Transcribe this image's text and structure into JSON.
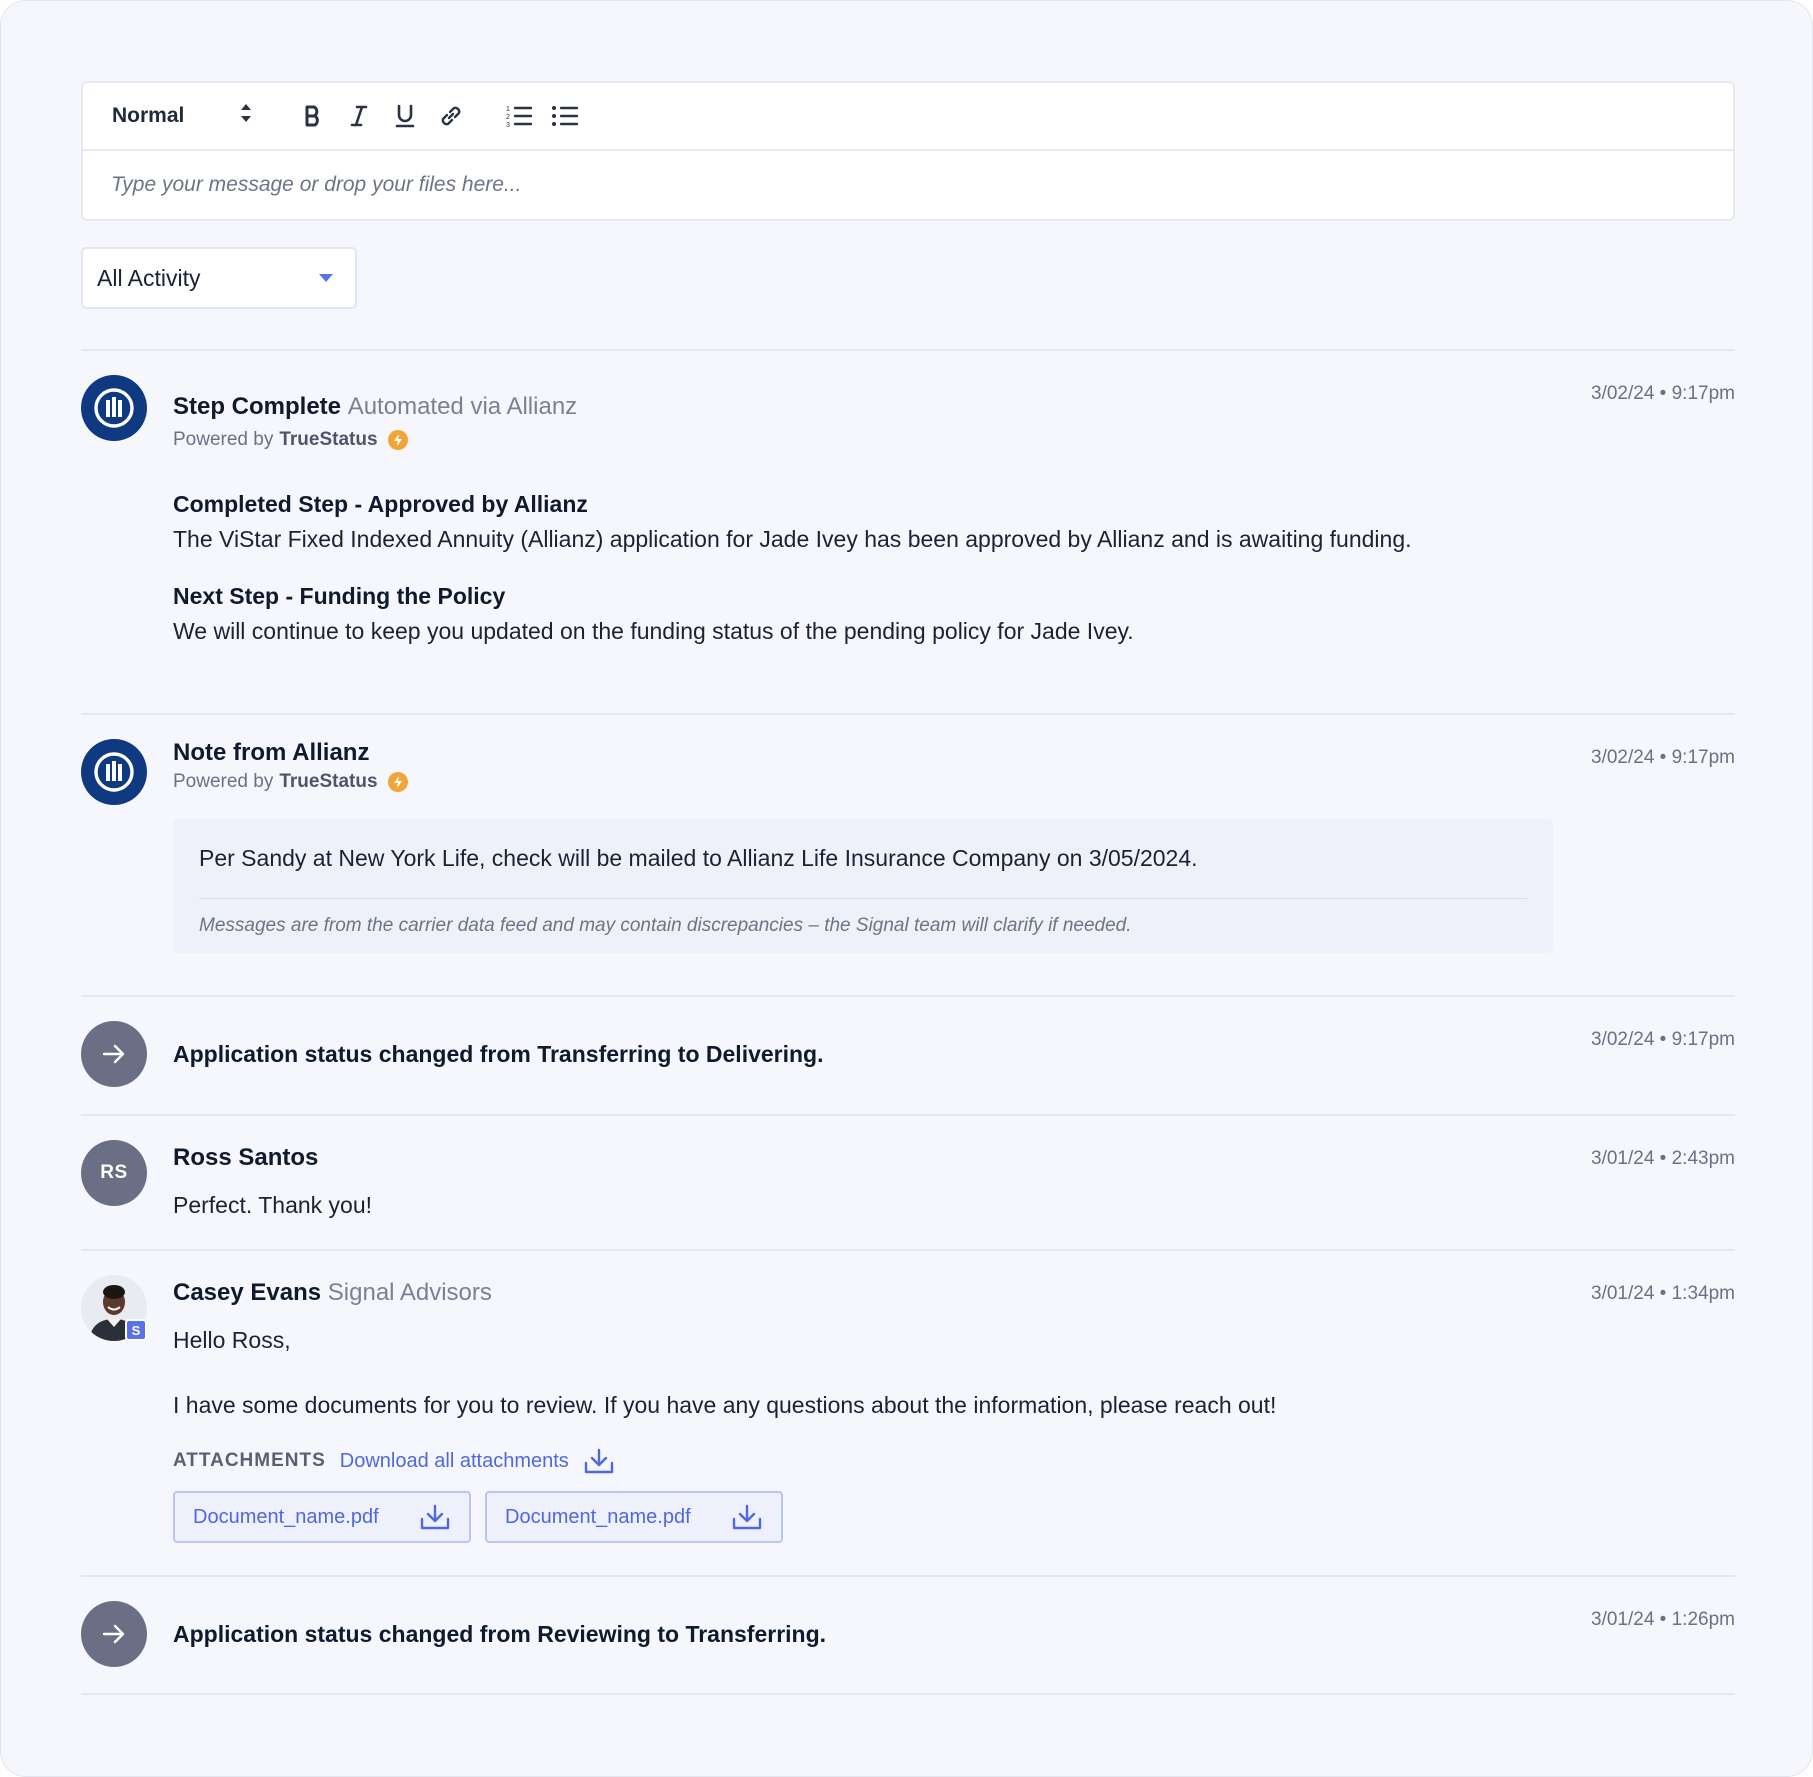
{
  "editor": {
    "format_label": "Normal",
    "placeholder": "Type your message or drop your files here..."
  },
  "filter": {
    "selected": "All Activity"
  },
  "feed": {
    "step": {
      "title": "Step Complete",
      "subtitle": "Automated via Allianz",
      "powered_prefix": "Powered by",
      "powered_brand": "TrueStatus",
      "timestamp": "3/02/24 • 9:17pm",
      "heading1": "Completed Step - Approved by Allianz",
      "text1": "The ViStar Fixed Indexed Annuity (Allianz) application for Jade Ivey has been approved by Allianz and is awaiting funding.",
      "heading2": "Next Step - Funding the Policy",
      "text2": "We will continue to keep you updated on the funding status of the pending policy for Jade Ivey."
    },
    "note": {
      "title": "Note from Allianz",
      "powered_prefix": "Powered by",
      "powered_brand": "TrueStatus",
      "timestamp": "3/02/24 • 9:17pm",
      "message": "Per Sandy at New York Life, check will be mailed to Allianz Life Insurance Company on 3/05/2024.",
      "disclaimer": "Messages are from the carrier data feed and may contain discrepancies – the Signal team will clarify if needed."
    },
    "status1": {
      "text": "Application status changed from Transferring to Delivering.",
      "timestamp": "3/02/24 • 9:17pm"
    },
    "ross": {
      "initials": "RS",
      "name": "Ross Santos",
      "timestamp": "3/01/24 • 2:43pm",
      "message": "Perfect. Thank you!"
    },
    "casey": {
      "name": "Casey Evans",
      "org": "Signal Advisors",
      "badge": "S",
      "timestamp": "3/01/24 • 1:34pm",
      "greeting": "Hello Ross,",
      "message": "I have some documents for you to review. If you have any questions about the information, please reach out!",
      "attachments_label": "ATTACHMENTS",
      "download_all": "Download all attachments",
      "files": [
        "Document_name.pdf",
        "Document_name.pdf"
      ]
    },
    "status2": {
      "text": "Application status changed from Reviewing to Transferring.",
      "timestamp": "3/01/24 • 1:26pm"
    }
  },
  "colors": {
    "accent": "#4f67e0",
    "allianz_blue": "#0f3a82",
    "status_gray": "#6a6f85",
    "bolt": "#f0a53a",
    "background": "#f6f7fc"
  }
}
